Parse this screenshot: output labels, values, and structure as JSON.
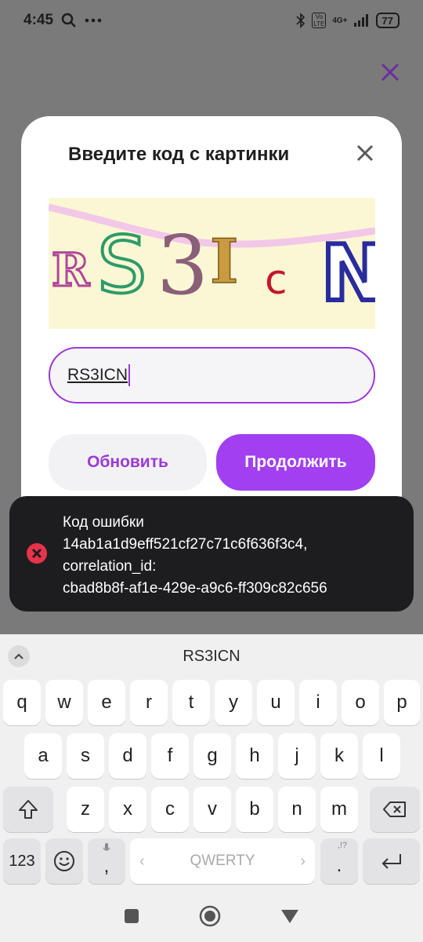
{
  "status_bar": {
    "time": "4:45",
    "network_label": "4G+",
    "volte_label": "Vo LTE",
    "battery": "77",
    "icons": [
      "search-icon",
      "more-icon",
      "bluetooth-icon",
      "signal-icon",
      "battery-icon"
    ]
  },
  "modal": {
    "title": "Введите код с картинки",
    "captcha_letters": [
      "R",
      "S",
      "3",
      "I",
      "c",
      "N"
    ],
    "input_value": "RS3ICN",
    "refresh_label": "Обновить",
    "continue_label": "Продолжить",
    "accent_color": "#a23ff0"
  },
  "toast": {
    "lines": [
      "Код ошибки",
      "14ab1a1d9eff521cf27c71c6f636f3c4,",
      "correlation_id:",
      "cbad8b8f-af1e-429e-a9c6-ff309c82c656"
    ],
    "error_color": "#e8334a"
  },
  "keyboard": {
    "suggestion": "RS3ICN",
    "row1": [
      "q",
      "w",
      "e",
      "r",
      "t",
      "y",
      "u",
      "i",
      "o",
      "p"
    ],
    "row2": [
      "a",
      "s",
      "d",
      "f",
      "g",
      "h",
      "j",
      "k",
      "l"
    ],
    "row3": [
      "z",
      "x",
      "c",
      "v",
      "b",
      "n",
      "m"
    ],
    "numbers_label": "123",
    "comma_label": ",",
    "space_label": "QWERTY",
    "period_label": ".",
    "period_hint": ",!?"
  }
}
